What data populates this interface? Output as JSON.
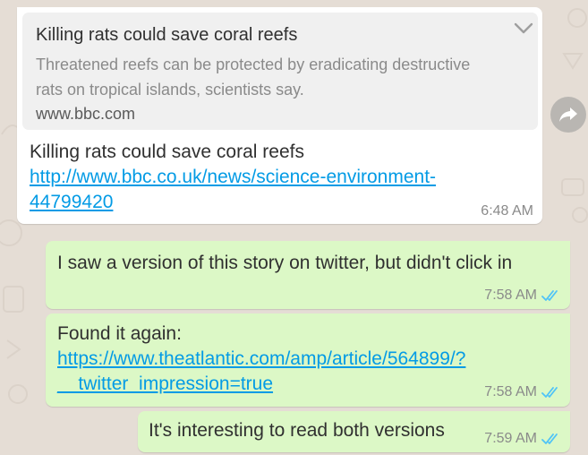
{
  "incoming": {
    "preview": {
      "title": "Killing rats could save coral reefs",
      "description_line1": "Threatened reefs can be protected by eradicating destructive",
      "description_line2": "rats on tropical islands, scientists say.",
      "site": "www.bbc.com"
    },
    "text": "Killing rats could save coral reefs",
    "link_line1": "http://www.bbc.co.uk/news/science-environment-",
    "link_line2": "44799420",
    "time": "6:48 AM"
  },
  "outgoing": [
    {
      "text": "I saw a version of this story on twitter, but didn't click in",
      "time": "7:58 AM",
      "status": "read"
    },
    {
      "text": "Found it again:",
      "link_line1": "https://www.theatlantic.com/amp/article/564899/?",
      "link_line2": "__twitter_impression=true",
      "time": "7:58 AM",
      "status": "read"
    },
    {
      "text": "It's interesting to read both versions",
      "time": "7:59 AM",
      "status": "read"
    }
  ],
  "icons": {
    "chevron": "chevron-down-icon",
    "forward": "forward-icon",
    "read_receipt": "double-check-icon"
  },
  "colors": {
    "background": "#e5ddd5",
    "incoming_bubble": "#ffffff",
    "outgoing_bubble": "#dcf8c6",
    "link": "#039be5",
    "read_ticks": "#4fc3f7",
    "meta_text": "#8a8a8a"
  }
}
